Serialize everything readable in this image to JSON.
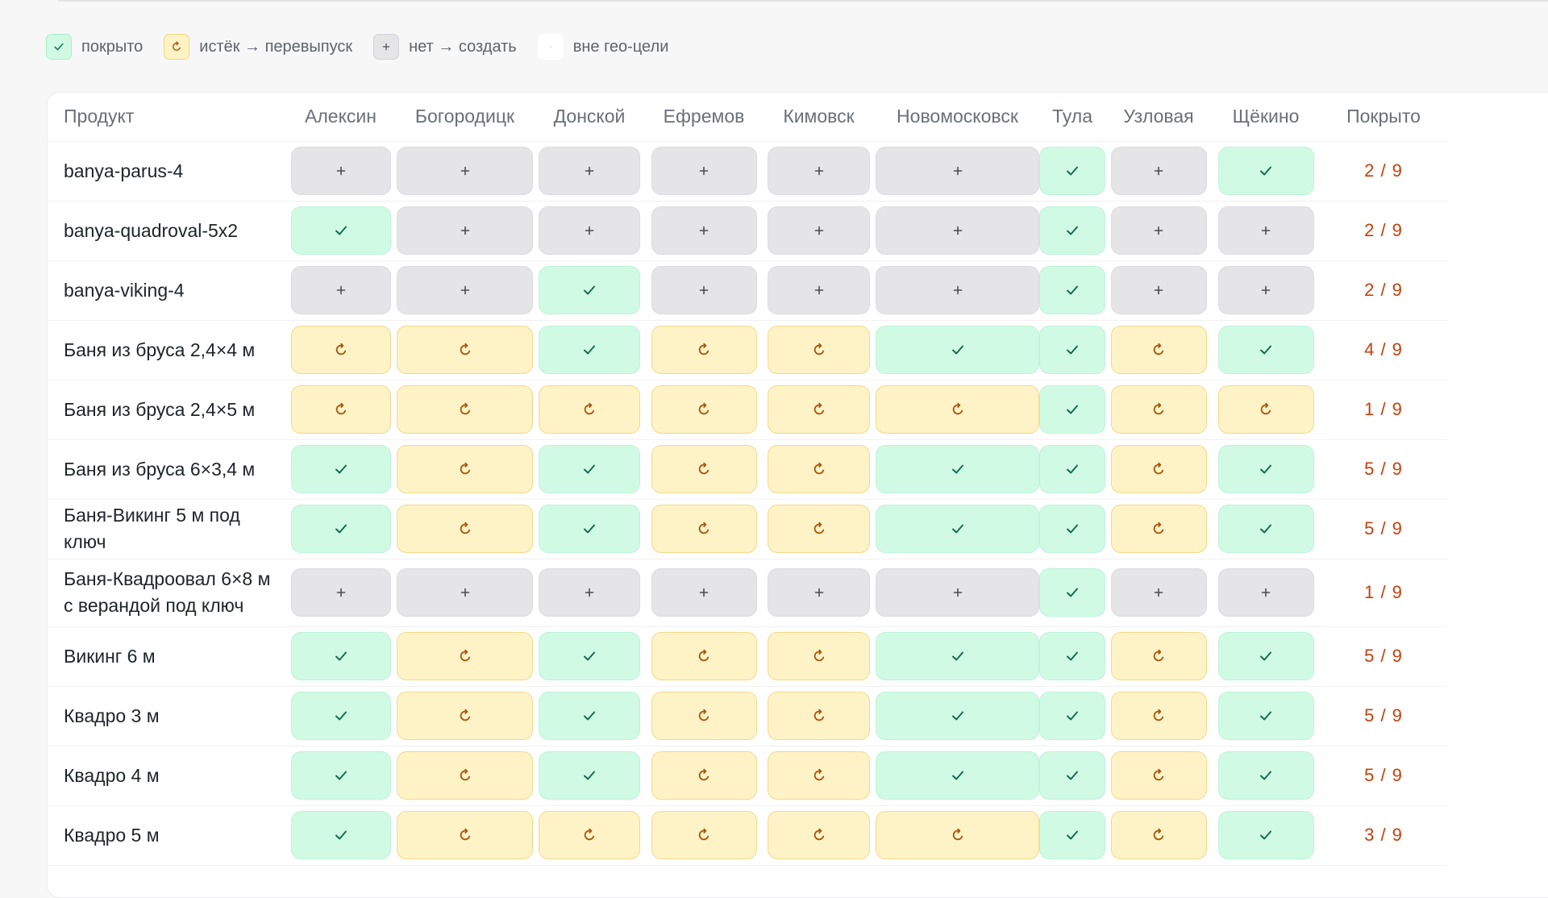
{
  "legend": [
    {
      "status": "ok",
      "icon": "check-icon",
      "label": "покрыто"
    },
    {
      "status": "expired",
      "icon": "refresh-icon",
      "label": "истёк → перевыпуск"
    },
    {
      "status": "none",
      "icon": "plus-icon",
      "label": "нет → создать"
    },
    {
      "status": "out",
      "icon": "dot-icon",
      "label": "вне гео-цели"
    }
  ],
  "table": {
    "product_header": "Продукт",
    "coverage_header": "Покрыто",
    "cities": [
      "Алексин",
      "Богородицк",
      "Донской",
      "Ефремов",
      "Кимовск",
      "Новомосковск",
      "Тула",
      "Узловая",
      "Щёкино"
    ],
    "rows": [
      {
        "product": "banya-parus-4",
        "cells": [
          "none",
          "none",
          "none",
          "none",
          "none",
          "none",
          "ok",
          "none",
          "ok"
        ],
        "coverage": "2 / 9"
      },
      {
        "product": "banya-quadroval-5x2",
        "cells": [
          "ok",
          "none",
          "none",
          "none",
          "none",
          "none",
          "ok",
          "none",
          "none"
        ],
        "coverage": "2 / 9"
      },
      {
        "product": "banya-viking-4",
        "cells": [
          "none",
          "none",
          "ok",
          "none",
          "none",
          "none",
          "ok",
          "none",
          "none"
        ],
        "coverage": "2 / 9"
      },
      {
        "product": "Баня из бруса 2,4×4 м",
        "cells": [
          "expired",
          "expired",
          "ok",
          "expired",
          "expired",
          "ok",
          "ok",
          "expired",
          "ok"
        ],
        "coverage": "4 / 9"
      },
      {
        "product": "Баня из бруса 2,4×5 м",
        "cells": [
          "expired",
          "expired",
          "expired",
          "expired",
          "expired",
          "expired",
          "ok",
          "expired",
          "expired"
        ],
        "coverage": "1 / 9"
      },
      {
        "product": "Баня из бруса 6×3,4 м",
        "cells": [
          "ok",
          "expired",
          "ok",
          "expired",
          "expired",
          "ok",
          "ok",
          "expired",
          "ok"
        ],
        "coverage": "5 / 9"
      },
      {
        "product": "Баня-Викинг 5 м под ключ",
        "cells": [
          "ok",
          "expired",
          "ok",
          "expired",
          "expired",
          "ok",
          "ok",
          "expired",
          "ok"
        ],
        "coverage": "5 / 9"
      },
      {
        "product": "Баня-Квадроовал 6×8 м с верандой под ключ",
        "cells": [
          "none",
          "none",
          "none",
          "none",
          "none",
          "none",
          "ok",
          "none",
          "none"
        ],
        "coverage": "1 / 9",
        "tall": true
      },
      {
        "product": "Викинг 6 м",
        "cells": [
          "ok",
          "expired",
          "ok",
          "expired",
          "expired",
          "ok",
          "ok",
          "expired",
          "ok"
        ],
        "coverage": "5 / 9"
      },
      {
        "product": "Квадро 3 м",
        "cells": [
          "ok",
          "expired",
          "ok",
          "expired",
          "expired",
          "ok",
          "ok",
          "expired",
          "ok"
        ],
        "coverage": "5 / 9"
      },
      {
        "product": "Квадро 4 м",
        "cells": [
          "ok",
          "expired",
          "ok",
          "expired",
          "expired",
          "ok",
          "ok",
          "expired",
          "ok"
        ],
        "coverage": "5 / 9"
      },
      {
        "product": "Квадро 5 м",
        "cells": [
          "ok",
          "expired",
          "expired",
          "expired",
          "expired",
          "expired",
          "ok",
          "expired",
          "ok"
        ],
        "coverage": "3 / 9"
      }
    ]
  },
  "colors": {
    "ok_bg": "#d1fae5",
    "expired_bg": "#fef3c7",
    "none_bg": "#e5e5e7",
    "coverage_text": "#c2410c"
  }
}
